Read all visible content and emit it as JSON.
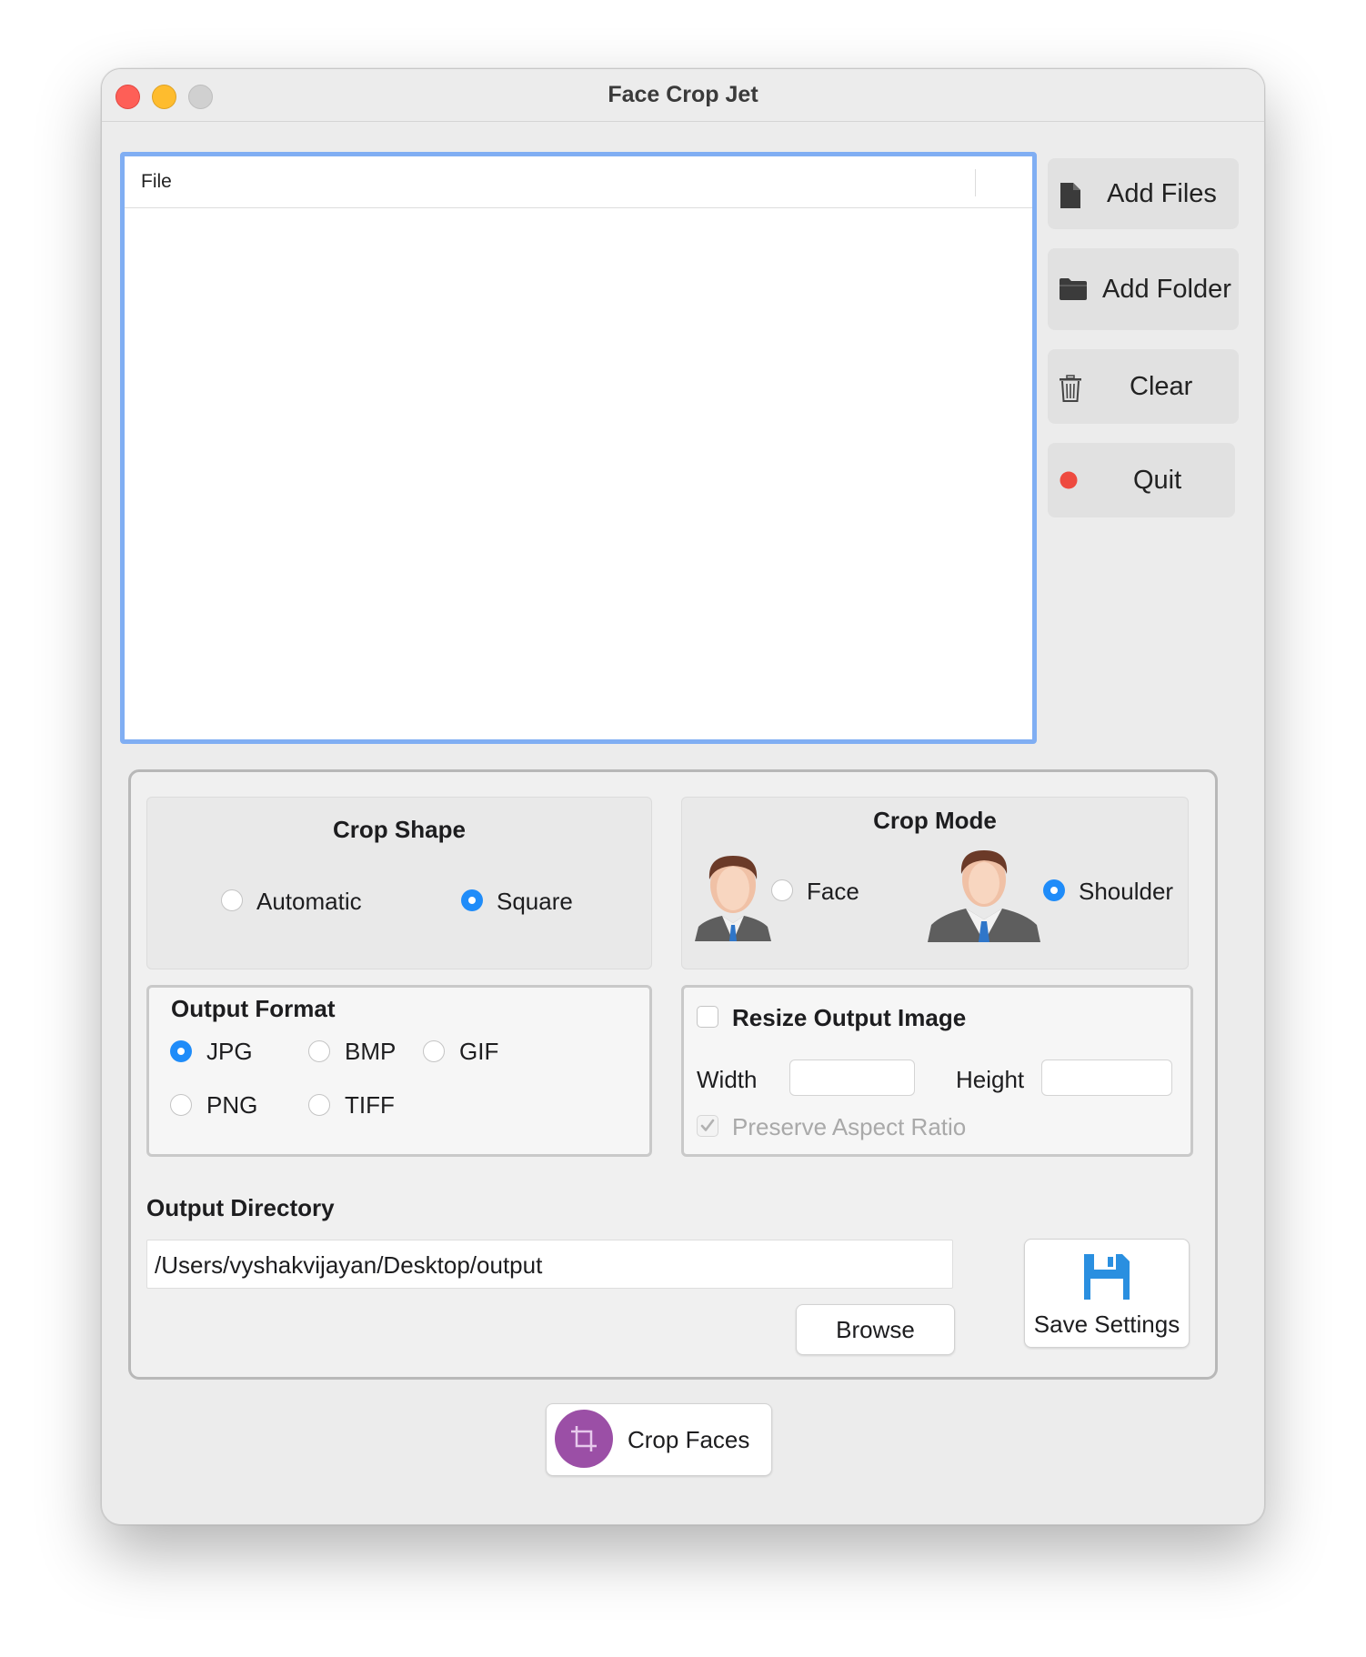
{
  "window": {
    "title": "Face Crop Jet"
  },
  "file_list": {
    "column_header": "File"
  },
  "side_buttons": {
    "add_files": "Add Files",
    "add_folder": "Add Folder",
    "clear": "Clear",
    "quit": "Quit"
  },
  "crop_shape": {
    "title": "Crop Shape",
    "options": [
      "Automatic",
      "Square"
    ],
    "selected": "Square"
  },
  "crop_mode": {
    "title": "Crop Mode",
    "options": [
      "Face",
      "Shoulder"
    ],
    "selected": "Shoulder"
  },
  "output_format": {
    "title": "Output Format",
    "options": [
      "JPG",
      "BMP",
      "GIF",
      "PNG",
      "TIFF"
    ],
    "selected": "JPG"
  },
  "resize": {
    "title": "Resize Output Image",
    "checked": false,
    "width_label": "Width",
    "height_label": "Height",
    "width_value": "",
    "height_value": "",
    "preserve_label": "Preserve Aspect Ratio",
    "preserve_checked": true,
    "preserve_enabled": false
  },
  "output_directory": {
    "title": "Output Directory",
    "path": "/Users/vyshakvijayan/Desktop/output",
    "browse_label": "Browse",
    "save_label": "Save Settings"
  },
  "crop_faces_label": "Crop Faces",
  "colors": {
    "accent": "#1f8cf9",
    "focus_ring": "#80aef3",
    "crop_faces_icon": "#9b4fa6",
    "quit_dot": "#ee4a3f",
    "save_icon": "#2a8fe0"
  }
}
